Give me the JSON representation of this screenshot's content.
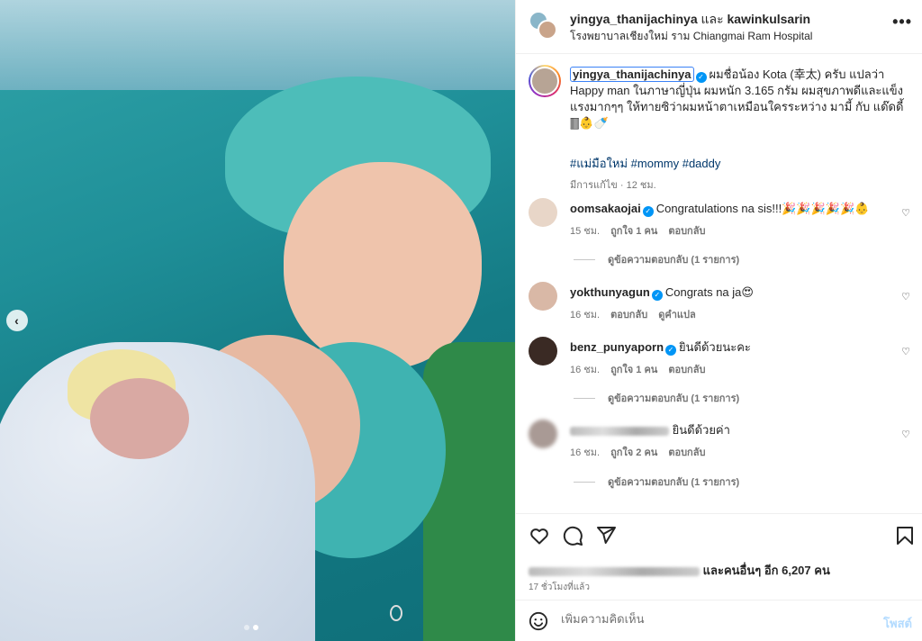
{
  "header": {
    "user1": "yingya_thanijachinya",
    "and": "และ",
    "user2": "kawinkulsarin",
    "location": "โรงพยาบาลเชียงใหม่ ราม Chiangmai Ram Hospital",
    "more_label": "•••"
  },
  "caption": {
    "username": "yingya_thanijachinya",
    "text": "ผมชื่อน้อง Kota (幸太) ครับ แปลว่า Happy man ในภาษาญี่ปุ่น ผมหนัก 3.165 กรัม ผมสุขภาพดีและแข็งแรงมากๆๆ ให้ทายซิว่าผมหน้าตาเหมือนใครระหว่าง มามี้ กับ แด๊ดดี้ 🀫👶🍼",
    "hashtags": "#แม่มือใหม่ #mommy #daddy",
    "edited": "มีการแก้ไข · 12 ชม."
  },
  "comments": [
    {
      "username": "oomsakaojai",
      "text": "Congratulations na sis!!!🎉🎉🎉🎉🎉👶",
      "time": "15 ชม.",
      "likes": "ถูกใจ 1 คน",
      "reply": "ตอบกลับ",
      "view_replies": "ดูข้อความตอบกลับ (1 รายการ)",
      "avatar_color": "#e8d6c8"
    },
    {
      "username": "yokthunyagun",
      "text": "Congrats na ja😍",
      "time": "16 ชม.",
      "reply": "ตอบกลับ",
      "translate": "ดูคำแปล",
      "avatar_color": "#d9b8a6"
    },
    {
      "username": "benz_punyaporn",
      "text": "ยินดีด้วยนะคะ",
      "time": "16 ชม.",
      "likes": "ถูกใจ 1 คน",
      "reply": "ตอบกลับ",
      "view_replies": "ดูข้อความตอบกลับ (1 รายการ)",
      "avatar_color": "#3a2a24"
    },
    {
      "username": "",
      "text": "ยินดีด้วยค่า",
      "time": "16 ชม.",
      "likes": "ถูกใจ 2 คน",
      "reply": "ตอบกลับ",
      "view_replies": "ดูข้อความตอบกลับ (1 รายการ)",
      "avatar_color": "#a99a95"
    }
  ],
  "likes": {
    "text": "และคนอื่นๆ อีก 6,207 คน"
  },
  "time_ago": "17 ชั่วโมงที่แล้ว",
  "add_comment": {
    "placeholder": "เพิ่มความคิดเห็น",
    "post": "โพสต์"
  },
  "icons": {
    "like": "heart-icon",
    "comment": "comment-icon",
    "share": "send-icon",
    "save": "bookmark-icon",
    "emoji": "emoji-icon",
    "prev": "chevron-left-icon"
  }
}
